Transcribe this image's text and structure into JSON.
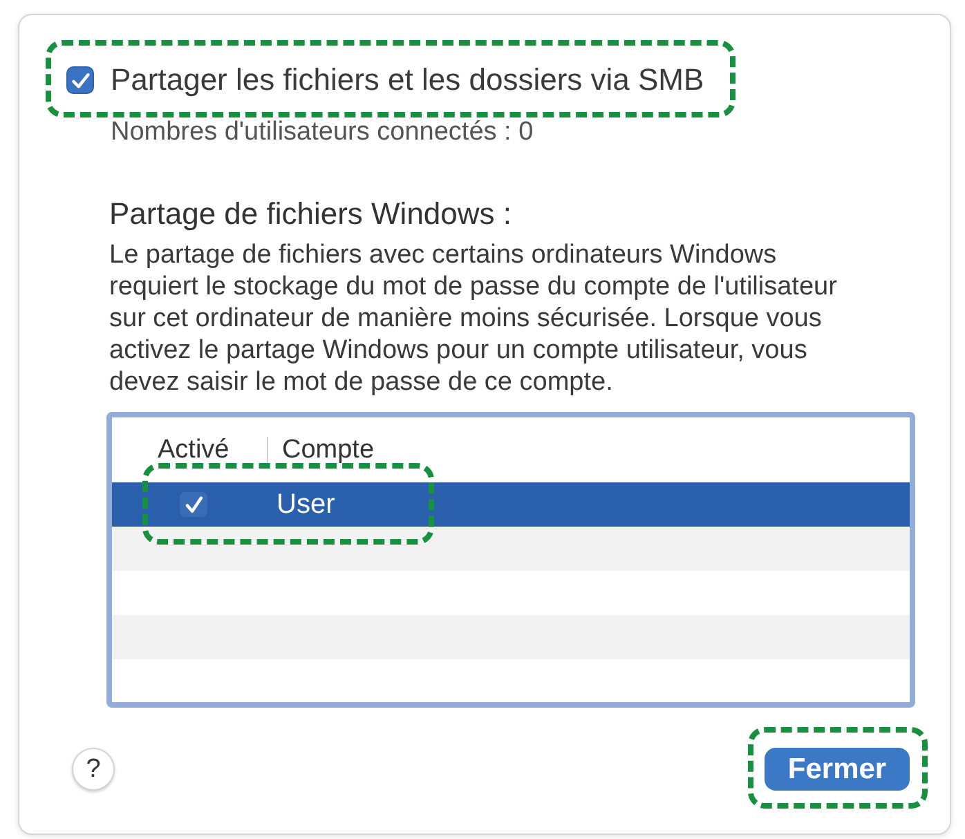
{
  "smb_sharing": {
    "label": "Partager les fichiers et les dossiers via SMB",
    "checked": true,
    "highlighted": true
  },
  "connected_users": "Nombres d'utilisateurs connectés : 0",
  "windows_sharing": {
    "title": "Partage de fichiers Windows :",
    "description": [
      "Le partage de fichiers avec certains ordinateurs Windows",
      "requiert le stockage du mot de passe du compte de l'utilisateur",
      "sur cet ordinateur de manière moins sécurisée. Lorsque vous",
      "activez le partage Windows pour un compte utilisateur, vous",
      "devez saisir le mot de passe de ce compte."
    ]
  },
  "accounts_table": {
    "columns": [
      "Activé",
      "Compte"
    ],
    "rows": [
      {
        "enabled": true,
        "account": "User",
        "selected": true,
        "highlighted": true
      }
    ]
  },
  "footer": {
    "help_button": "?",
    "close_button": {
      "label": "Fermer",
      "highlighted": true
    }
  }
}
